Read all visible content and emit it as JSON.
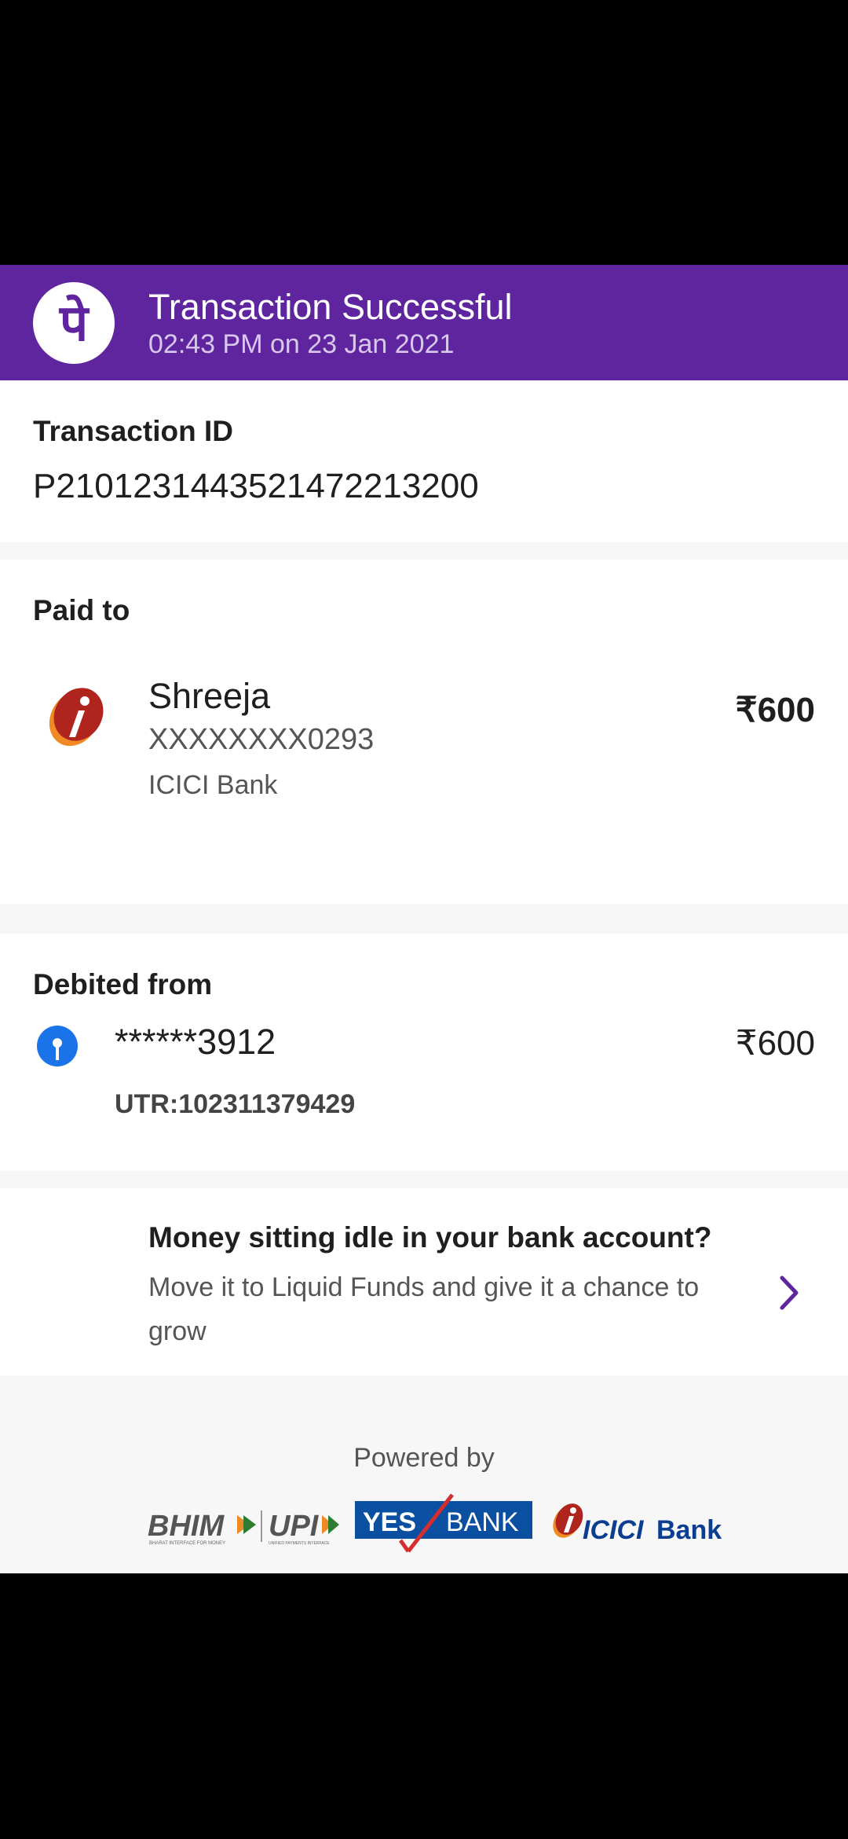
{
  "header": {
    "logo_glyph": "पे",
    "title": "Transaction Successful",
    "subtitle": "02:43 PM on 23 Jan 2021",
    "color": "#5f259f"
  },
  "transaction": {
    "label": "Transaction ID",
    "id": "P2101231443521472213200"
  },
  "paid_to": {
    "label": "Paid to",
    "name": "Shreeja",
    "account": "XXXXXXXX0293",
    "bank": "ICICI Bank",
    "amount": "₹600",
    "icon": "icici-logo-icon"
  },
  "debited_from": {
    "label": "Debited from",
    "account": "******3912",
    "utr": "UTR:102311379429",
    "amount": "₹600",
    "icon": "sbi-logo-icon"
  },
  "promo": {
    "title": "Money sitting idle in your bank account?",
    "description": "Move it to Liquid Funds and give it a chance to grow",
    "icon": "chevron-right-icon"
  },
  "footer": {
    "powered_by": "Powered by",
    "bhim": "BHIM",
    "bhim_tagline": "BHARAT INTERFACE FOR MONEY",
    "upi": "UPI",
    "upi_tagline": "UNIFIED PAYMENTS INTERFACE",
    "yes_bank_left": "YES",
    "yes_bank_right": "BANK",
    "icici": "ICICI",
    "icici_bank": "Bank"
  }
}
